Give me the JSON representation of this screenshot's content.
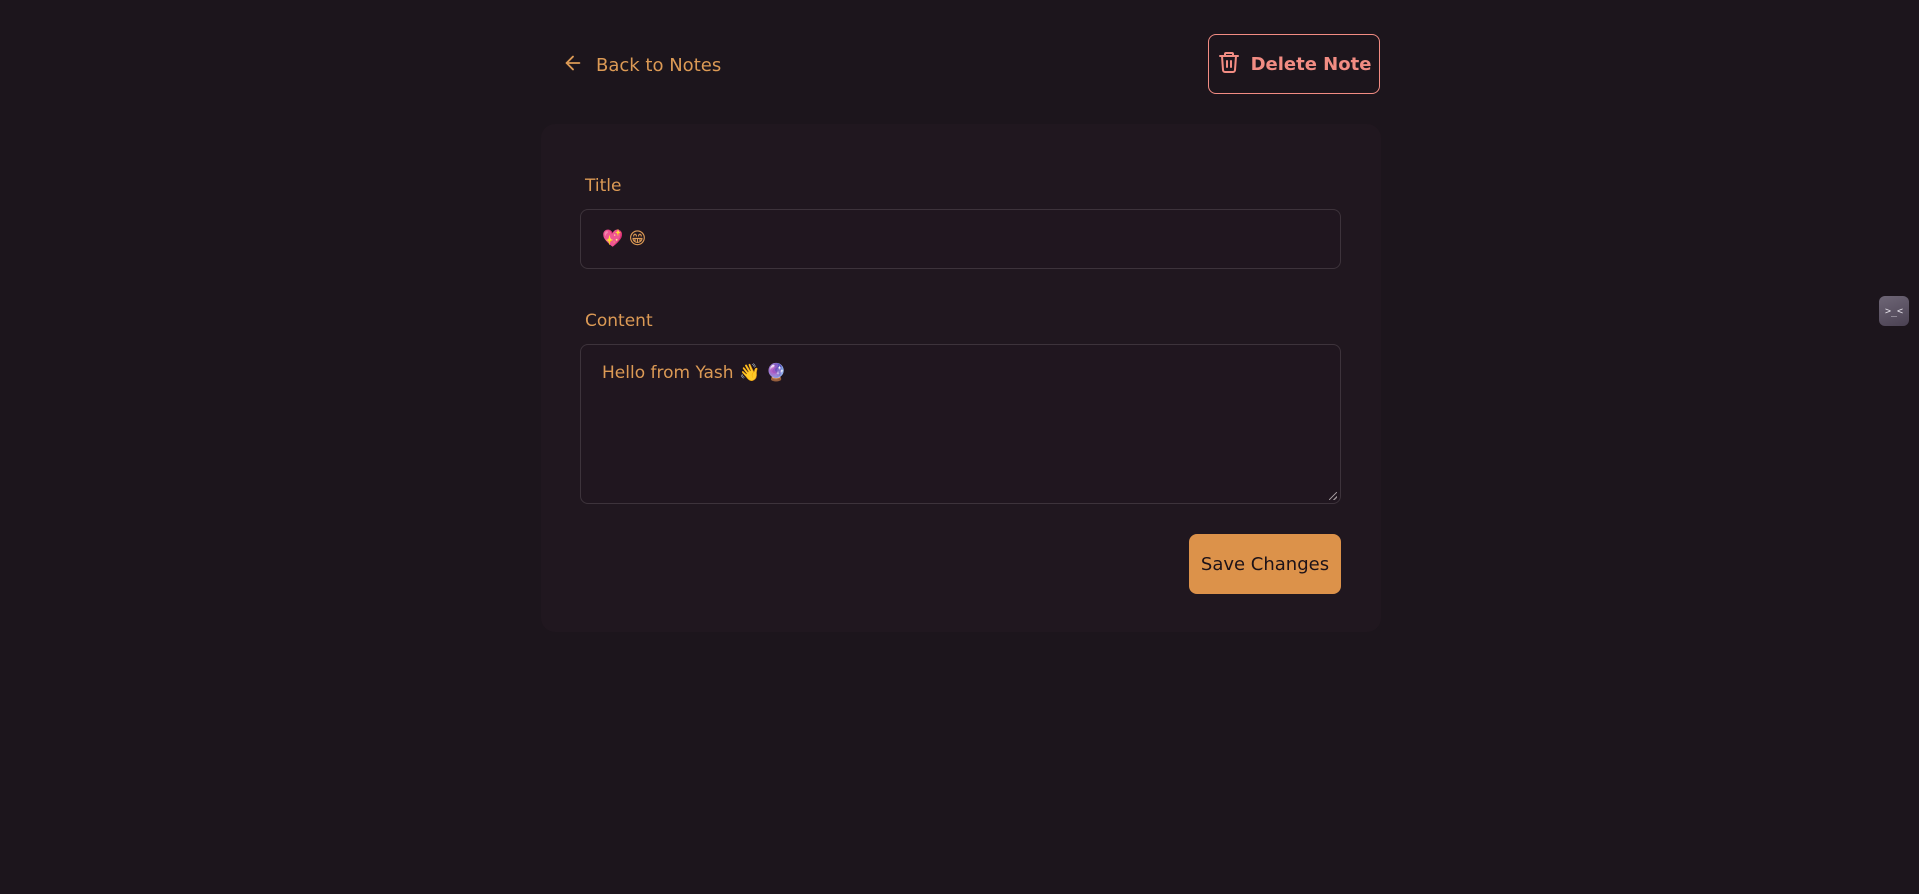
{
  "header": {
    "back_label": "Back to Notes",
    "delete_label": "Delete Note"
  },
  "form": {
    "title_label": "Title",
    "title_value": "💖 😁",
    "content_label": "Content",
    "content_value": "Hello from Yash 👋 🔮",
    "save_label": "Save Changes"
  },
  "side_widget": {
    "icon": "terminal-icon",
    "glyph": ">_<"
  },
  "colors": {
    "background": "#1c151c",
    "card": "#20171f",
    "accent": "#dc9a55",
    "danger": "#f28c83",
    "button": "#dc924a"
  }
}
